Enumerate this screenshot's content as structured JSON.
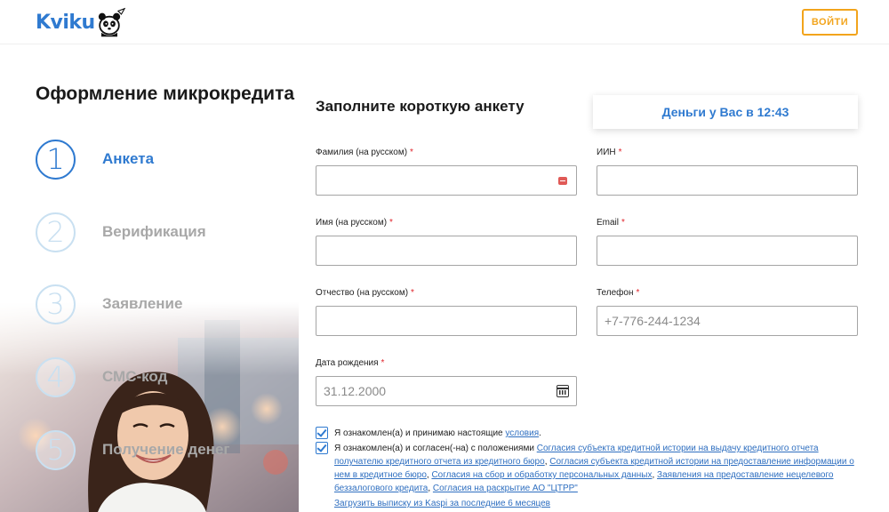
{
  "header": {
    "logo_text": "Kviku",
    "login_label": "ВОЙТИ"
  },
  "page_title": "Оформление микрокредита",
  "steps": [
    {
      "number": "1",
      "label": "Анкета",
      "active": true
    },
    {
      "number": "2",
      "label": "Верификация",
      "active": false
    },
    {
      "number": "3",
      "label": "Заявление",
      "active": false
    },
    {
      "number": "4",
      "label": "СМС-код",
      "active": false
    },
    {
      "number": "5",
      "label": "Получение денег",
      "active": false
    }
  ],
  "form": {
    "title": "Заполните короткую анкету",
    "timer": "Деньги у Вас в 12:43",
    "required_mark": "*",
    "fields": {
      "last_name": {
        "label": "Фамилия (на русском)",
        "value": "",
        "placeholder": ""
      },
      "iin": {
        "label": "ИИН",
        "value": "",
        "placeholder": ""
      },
      "first_name": {
        "label": "Имя (на русском)",
        "value": "",
        "placeholder": ""
      },
      "email": {
        "label": "Email",
        "value": "",
        "placeholder": ""
      },
      "patronymic": {
        "label": "Отчество (на русском)",
        "value": "",
        "placeholder": ""
      },
      "phone": {
        "label": "Телефон",
        "value": "",
        "placeholder": "+7-776-244-1234"
      },
      "birth_date": {
        "label": "Дата рождения",
        "value": "",
        "placeholder": "31.12.2000"
      }
    }
  },
  "consents": {
    "first": {
      "text": "Я ознакомлен(а) и принимаю настоящие ",
      "link": "условия",
      "tail": "."
    },
    "second": {
      "text": "Я ознакомлен(а) и согласен(-на) с положениями ",
      "link1": "Согласия субъекта кредитной истории на выдачу кредитного отчета получателю кредитного отчета из кредитного бюро",
      "sep1": ", ",
      "link2": "Согласия субъекта кредитной истории на предоставление информации о нем в кредитное бюро",
      "sep2": ", ",
      "link3": "Согласия на сбор и обработку персональных данных",
      "sep3": ", ",
      "link4": "Заявления на предоставление нецелевого беззалогового кредита",
      "sep4": ", ",
      "link5": "Согласия на раскрытие АО \"ЦТРР\""
    },
    "kaspi_link": "Загрузить выписку из Kaspi за последние 6 месяцев"
  },
  "colors": {
    "brand_blue": "#2f7ad0",
    "accent_orange": "#f2a41c",
    "required_red": "#e0242b"
  }
}
